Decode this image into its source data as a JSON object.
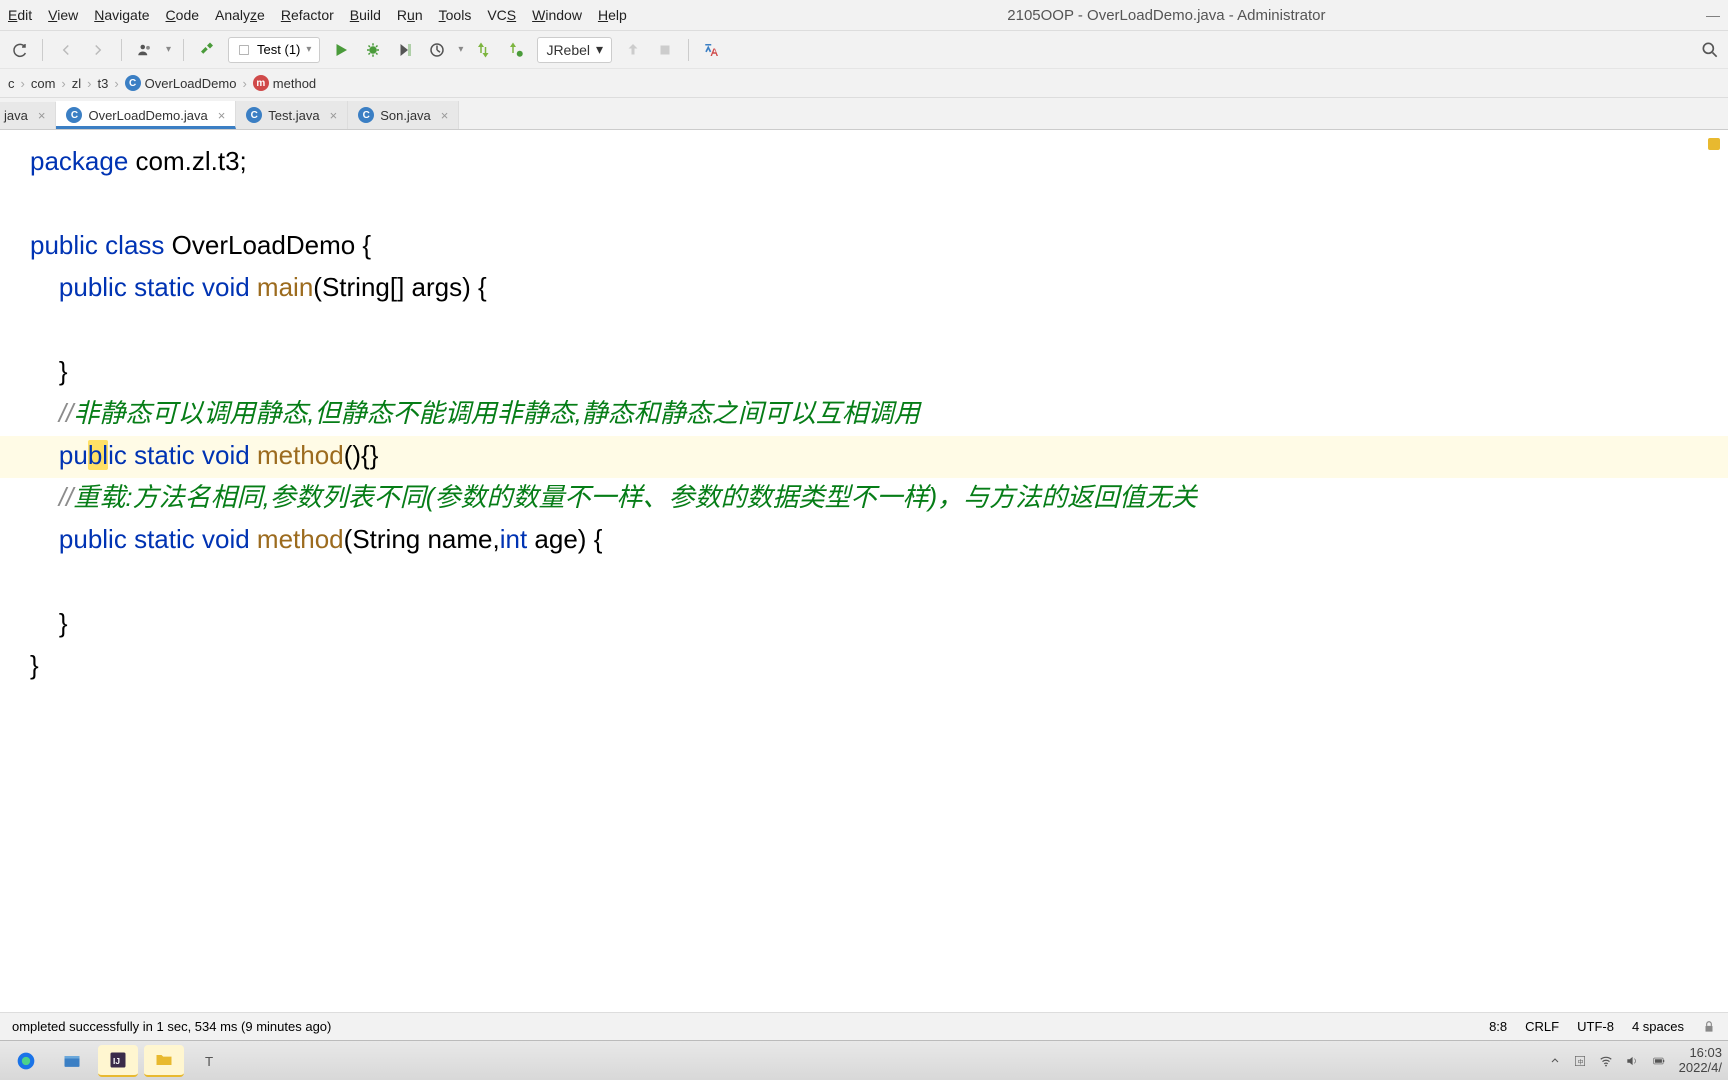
{
  "menubar": {
    "items": [
      "Edit",
      "View",
      "Navigate",
      "Code",
      "Analyze",
      "Refactor",
      "Build",
      "Run",
      "Tools",
      "VCS",
      "Window",
      "Help"
    ]
  },
  "window_title": "2105OOP - OverLoadDemo.java - Administrator",
  "run_config": {
    "label": "Test (1)"
  },
  "jrebel": {
    "label": "JRebel"
  },
  "breadcrumb": {
    "0": "c",
    "1": "com",
    "2": "zl",
    "3": "t3",
    "4": "OverLoadDemo",
    "5": "method"
  },
  "tabs": {
    "0": "java",
    "1": "OverLoadDemo.java",
    "2": "Test.java",
    "3": "Son.java"
  },
  "code": {
    "l1_a": "package",
    "l1_b": " com.zl.t3;",
    "l3_a": "public",
    "l3_b": " ",
    "l3_c": "class",
    "l3_d": " OverLoadDemo {",
    "l4_a": "    public",
    "l4_b": " ",
    "l4_c": "static",
    "l4_d": " ",
    "l4_e": "void",
    "l4_f": " ",
    "l4_g": "main",
    "l4_h": "(String[] args) {",
    "l5": "",
    "l6": "    }",
    "l7_a": "    //",
    "l7_b": "非静态可以调用静态,但静态不能调用非静态,静态和静态之间可以互相调用",
    "l8_pre": "    pu",
    "l8_hl": "bl",
    "l8_post": "ic",
    "l8_b": " ",
    "l8_c": "static",
    "l8_d": " ",
    "l8_e": "void",
    "l8_f": " ",
    "l8_g": "method",
    "l8_h": "(){}",
    "l9_a": "    //",
    "l9_b": "重载:方法名相同,参数列表不同(参数的数量不一样、参数的数据类型不一样)，与方法的返回值无关",
    "l10_a": "    public",
    "l10_b": " ",
    "l10_c": "static",
    "l10_d": " ",
    "l10_e": "void",
    "l10_f": " ",
    "l10_g": "method",
    "l10_h": "(String name,",
    "l10_i": "int",
    "l10_j": " age) {",
    "l11": "",
    "l12": "    }",
    "l13": "}"
  },
  "statusbar": {
    "message": "ompleted successfully in 1 sec, 534 ms (9 minutes ago)",
    "pos": "8:8",
    "linesep": "CRLF",
    "encoding": "UTF-8",
    "indent": "4 spaces"
  },
  "tray": {
    "time": "16:03",
    "date": "2022/4/"
  }
}
